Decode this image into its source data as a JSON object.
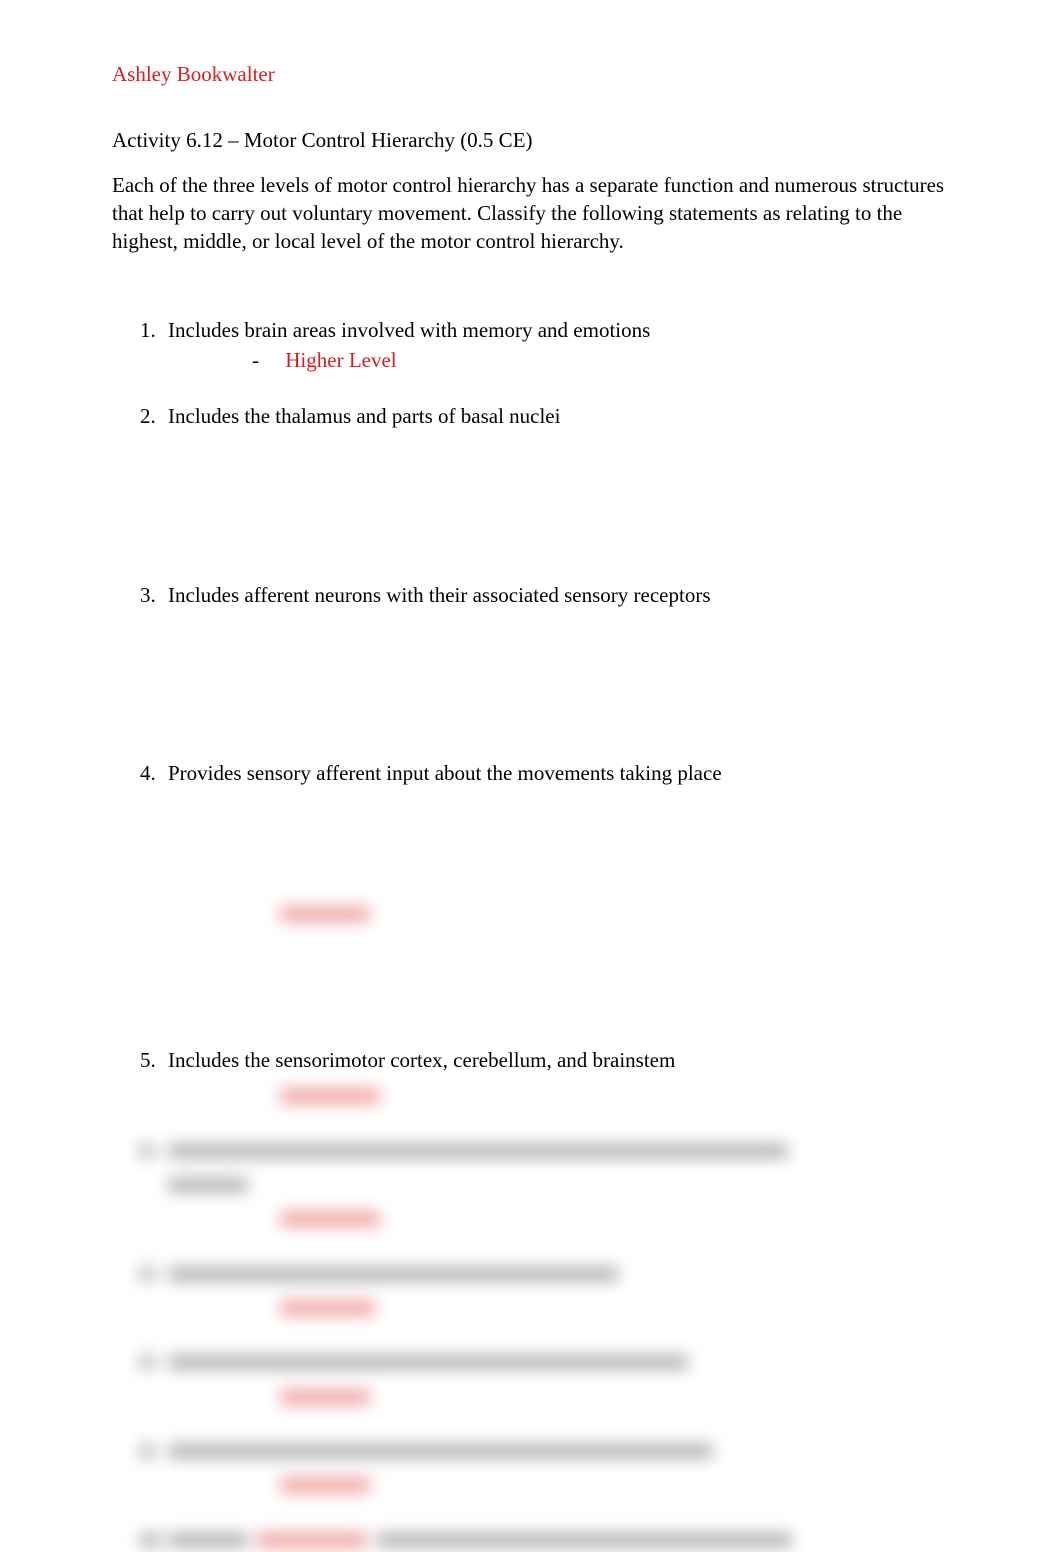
{
  "author": "Ashley Bookwalter",
  "title": "Activity 6.12 – Motor Control Hierarchy (0.5 CE)",
  "intro": "Each of the three levels of motor control hierarchy has a separate function and numerous structures that help to carry out voluntary movement. Classify the following statements as relating to the   highest, middle, or local level of the motor control hierarchy.",
  "questions": [
    {
      "num": "1.",
      "text": "Includes brain areas involved with memory and emotions",
      "answer": "Higher Level",
      "answer_visible": true
    },
    {
      "num": "2.",
      "text": "Includes the thalamus and parts of basal nuclei",
      "answer": "",
      "answer_visible": false
    },
    {
      "num": "3.",
      "text": "Includes afferent neurons with their associated sensory receptors",
      "answer": "",
      "answer_visible": false
    },
    {
      "num": "4.",
      "text": "Provides sensory afferent input about the movements taking place",
      "answer": "",
      "answer_visible": false
    },
    {
      "num": "5.",
      "text": "Includes the sensorimotor cortex, cerebellum, and brainstem",
      "answer": "",
      "answer_visible": false
    }
  ],
  "blurred_questions": [
    {
      "num": "6.",
      "q_width": 620,
      "a_width": 100
    },
    {
      "num": "7.",
      "q_width": 450,
      "a_width": 95
    },
    {
      "num": "8.",
      "q_width": 520,
      "a_width": 90
    },
    {
      "num": "9.",
      "q_width": 545,
      "a_width": 90
    },
    {
      "num": "10.",
      "q_width": 615,
      "a_width": 0
    }
  ]
}
